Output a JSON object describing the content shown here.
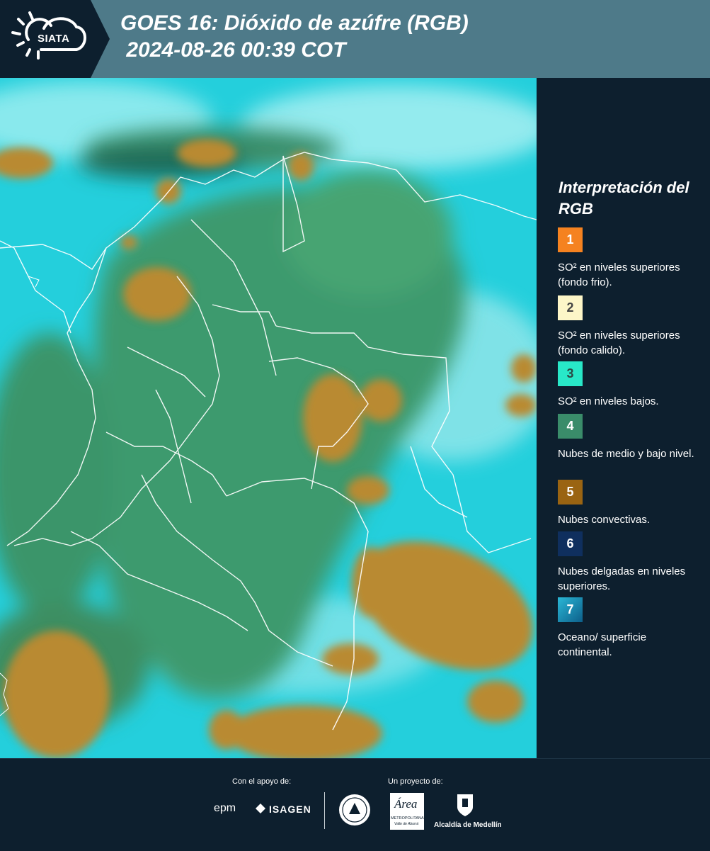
{
  "header": {
    "logo_text": "SIATA",
    "title_line1": "GOES 16: Dióxido de azúfre (RGB)",
    "title_line2": " 2024-08-26 00:39 COT"
  },
  "legend": {
    "title": "Interpretación del RGB",
    "items": [
      {
        "number": "1",
        "color": "#f58220",
        "text": "SO² en niveles superiores (fondo frio)."
      },
      {
        "number": "2",
        "color": "#fdf6c8",
        "text": "SO² en niveles superiores (fondo calido)."
      },
      {
        "number": "3",
        "color": "#28e8c8",
        "text": "SO² en niveles bajos."
      },
      {
        "number": "4",
        "color": "#3a8c6a",
        "text": "Nubes de medio y bajo nivel."
      },
      {
        "number": "5",
        "color": "#9a6412",
        "text": "Nubes convectivas."
      },
      {
        "number": "6",
        "color": "#0f2f5e",
        "text": "Nubes delgadas en niveles superiores."
      },
      {
        "number": "7",
        "color": "#1a8fb8",
        "text": "Oceano/ superficie continental."
      }
    ]
  },
  "map": {
    "colors": {
      "ocean": "#1fcfdd",
      "land": "#3f9a70",
      "convective": "#b4862f",
      "high_cloud": "#8ee9ec"
    }
  },
  "footer": {
    "support_label": "Con el apoyo de:",
    "sponsor1": "epm",
    "sponsor2": "ISAGEN",
    "project_label": "Un proyecto de:",
    "partner1": "Área",
    "partner1_sub": "METROPOLITANA",
    "partner1_sub2": "Valle de Aburrá",
    "partner2": "Alcaldía de Medellín"
  }
}
